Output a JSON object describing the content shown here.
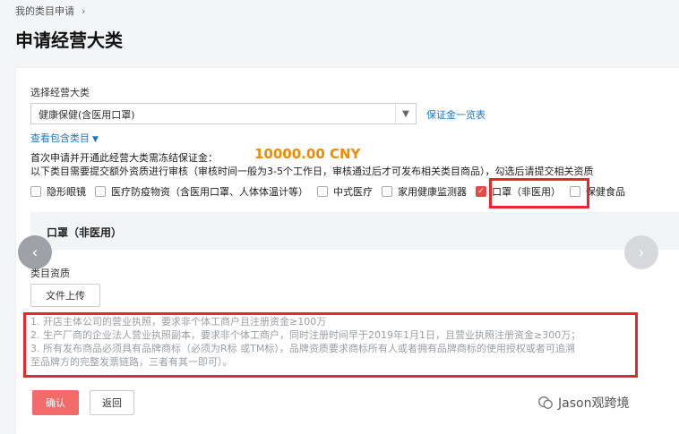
{
  "breadcrumb": {
    "text": "我的类目申请",
    "chev": "›"
  },
  "page_title": "申请经营大类",
  "form": {
    "category_label": "选择经营大类",
    "category_value": "健康保健(含医用口罩)",
    "deposit_link": "保证金一览表",
    "view_subcategories": "查看包含类目",
    "deposit_text": "首次申请并开通此经营大类需冻结保证金：",
    "deposit_amount": "10000.00 CNY",
    "requirement_text": "以下类目需要提交额外资质进行审核（审核时间一般为3-5个工作日，审核通过后才可发布相关类目商品），勾选后请提交相关资质",
    "checkboxes": [
      {
        "label": "隐形眼镜",
        "checked": false
      },
      {
        "label": "医疗防疫物资（含医用口罩、人体体温计等）",
        "checked": false
      },
      {
        "label": "中式医疗",
        "checked": false
      },
      {
        "label": "家用健康监测器",
        "checked": false
      },
      {
        "label": "口罩（非医用）",
        "checked": true
      },
      {
        "label": "保健食品",
        "checked": false
      }
    ]
  },
  "section": {
    "title": "口罩（非医用）",
    "qualification_label": "类目资质",
    "upload_label": "文件上传",
    "notes": [
      "1. 开店主体公司的营业执照，要求非个体工商户且注册资金≥100万",
      "2. 生产厂商的企业法人营业执照副本，要求非个体工商户，同时注册时间早于2019年1月1日，且营业执照注册资金≥300万；",
      "3. 所有发布商品必须具有品牌商标（必须为R标 或TM标），品牌资质要求商标所有人或者拥有品牌商标的使用授权或者可追溯",
      "至品牌方的完整发票链路，三者有其一即可）。"
    ]
  },
  "actions": {
    "confirm": "确认",
    "back": "返回"
  },
  "watermark": "Jason观跨境",
  "colors": {
    "accent_link": "#1e78c8",
    "amount": "#f08a00",
    "highlight": "#e8262c",
    "confirm_btn": "#f26a6a"
  }
}
